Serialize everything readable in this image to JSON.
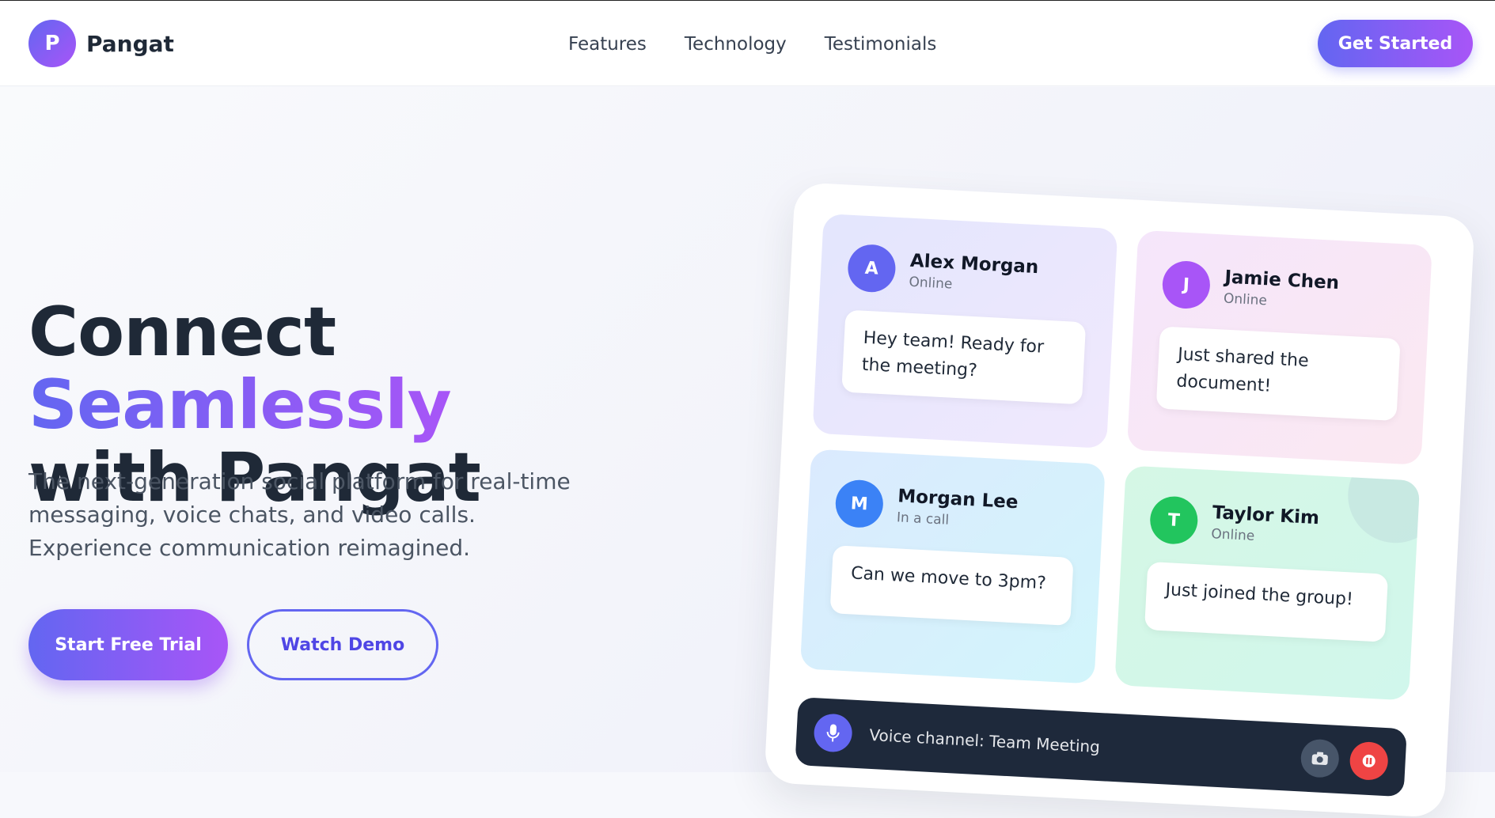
{
  "brand": {
    "initial": "P",
    "name": "Pangat"
  },
  "nav": {
    "items": [
      {
        "label": "Features"
      },
      {
        "label": "Technology"
      },
      {
        "label": "Testimonials"
      }
    ],
    "cta": "Get Started"
  },
  "hero": {
    "title_part1": "Connect ",
    "title_highlight": "Seamlessly",
    "title_part2": "with Pangat",
    "subtitle": "The next-generation social platform for real-time messaging, voice chats, and video calls. Experience communication reimagined.",
    "primary_button": "Start Free Trial",
    "secondary_button": "Watch Demo"
  },
  "mockup": {
    "chats": [
      {
        "initial": "A",
        "name": "Alex Morgan",
        "status": "Online",
        "message": "Hey team! Ready for the meeting?",
        "color": "#6366f1"
      },
      {
        "initial": "J",
        "name": "Jamie Chen",
        "status": "Online",
        "message": "Just shared the document!",
        "color": "#a855f7"
      },
      {
        "initial": "M",
        "name": "Morgan Lee",
        "status": "In a call",
        "message": "Can we move to 3pm?",
        "color": "#3b82f6"
      },
      {
        "initial": "T",
        "name": "Taylor Kim",
        "status": "Online",
        "message": "Just joined the group!",
        "color": "#22c55e"
      }
    ],
    "voice_channel": {
      "label": "Voice channel: Team Meeting"
    }
  },
  "colors": {
    "accent_start": "#6366f1",
    "accent_end": "#a855f7",
    "dark": "#1e293b",
    "end_call": "#ef4444"
  }
}
